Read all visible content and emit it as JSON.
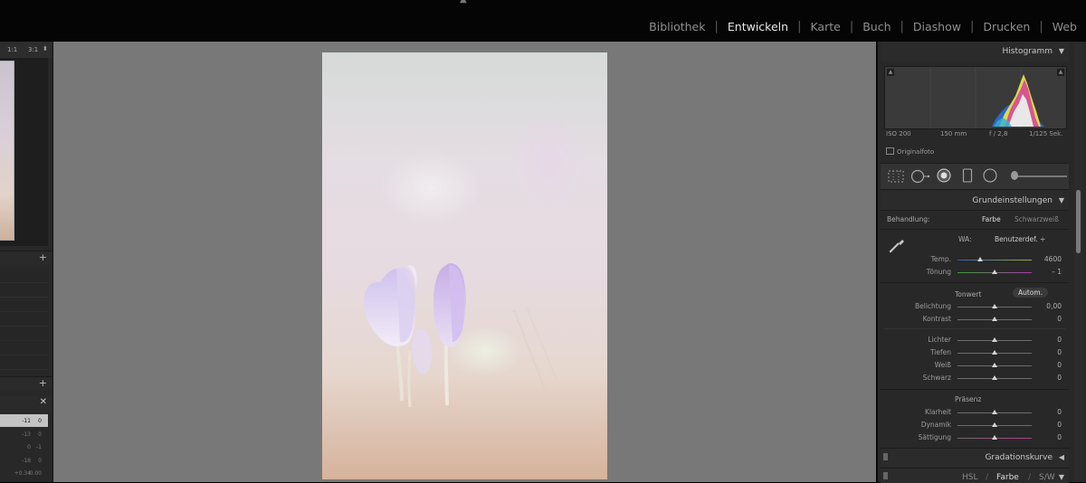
{
  "top": {
    "modules": [
      "Bibliothek",
      "Entwickeln",
      "Karte",
      "Buch",
      "Diashow",
      "Drucken",
      "Web"
    ],
    "active_module": "Entwickeln"
  },
  "left": {
    "zoom_options": [
      "1:1",
      "3:1"
    ],
    "history_rows": [
      {
        "a": "-11",
        "b": "0",
        "selected": true
      },
      {
        "a": "-13",
        "b": "0",
        "selected": false
      },
      {
        "a": "0",
        "b": "-1",
        "selected": false
      },
      {
        "a": "-18",
        "b": "0",
        "selected": false
      },
      {
        "a": "+0.34",
        "b": "0.00",
        "selected": false
      }
    ]
  },
  "right": {
    "histogram_title": "Histogramm",
    "exif": {
      "iso": "ISO 200",
      "focal": "150 mm",
      "aperture": "f / 2,8",
      "shutter": "1/125 Sek."
    },
    "original_label": "Originalfoto",
    "basic_title": "Grundeinstellungen",
    "treatment_label": "Behandlung:",
    "treatment_color": "Farbe",
    "treatment_bw": "Schwarzweiß",
    "wb_label": "WA:",
    "wb_value": "Benutzerdef. ÷",
    "temp": {
      "label": "Temp.",
      "value": "4600",
      "pos": 0.3
    },
    "tint": {
      "label": "Tönung",
      "value": "– 1",
      "pos": 0.5
    },
    "tone_label": "Tonwert",
    "auto_label": "Autom.",
    "exposure": {
      "label": "Belichtung",
      "value": "0,00",
      "pos": 0.5
    },
    "contrast": {
      "label": "Kontrast",
      "value": "0",
      "pos": 0.5
    },
    "highlights": {
      "label": "Lichter",
      "value": "0",
      "pos": 0.5
    },
    "shadows": {
      "label": "Tiefen",
      "value": "0",
      "pos": 0.5
    },
    "whites": {
      "label": "Weiß",
      "value": "0",
      "pos": 0.5
    },
    "blacks": {
      "label": "Schwarz",
      "value": "0",
      "pos": 0.5
    },
    "presence_label": "Präsenz",
    "clarity": {
      "label": "Klarheit",
      "value": "0",
      "pos": 0.5
    },
    "vibrance": {
      "label": "Dynamik",
      "value": "0",
      "pos": 0.5
    },
    "saturation": {
      "label": "Sättigung",
      "value": "0",
      "pos": 0.5
    },
    "curve_title": "Gradationskurve",
    "hsl_tabs": [
      "HSL",
      "Farbe",
      "S/W"
    ],
    "hsl_sep": "/"
  },
  "colors": {
    "panel_bg": "#282828",
    "center_bg": "#787878",
    "active_text": "#e8e8e8"
  }
}
